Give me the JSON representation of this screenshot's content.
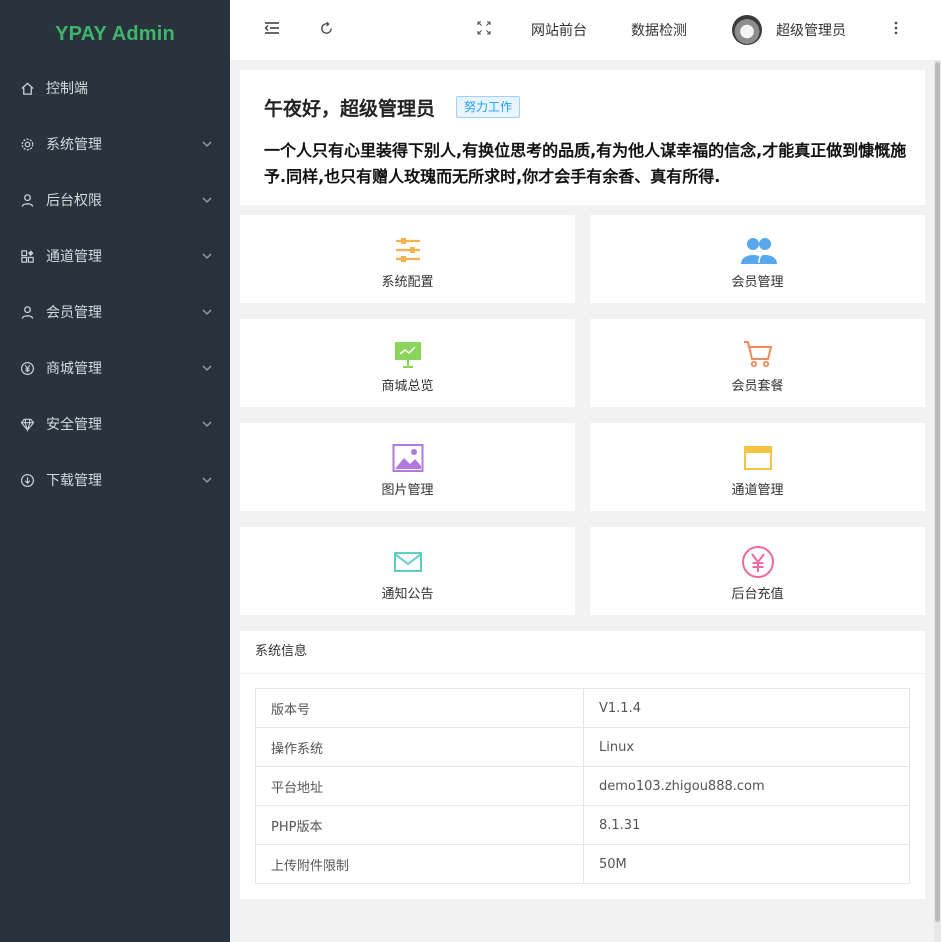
{
  "brand": "YPAY Admin",
  "sidebar": {
    "items": [
      {
        "label": "控制端",
        "icon": "home-icon",
        "has_children": false
      },
      {
        "label": "系统管理",
        "icon": "gear-icon",
        "has_children": true
      },
      {
        "label": "后台权限",
        "icon": "user-icon",
        "has_children": true
      },
      {
        "label": "通道管理",
        "icon": "apps-icon",
        "has_children": true
      },
      {
        "label": "会员管理",
        "icon": "user-icon",
        "has_children": true
      },
      {
        "label": "商城管理",
        "icon": "yen-icon",
        "has_children": true
      },
      {
        "label": "安全管理",
        "icon": "diamond-icon",
        "has_children": true
      },
      {
        "label": "下载管理",
        "icon": "download-icon",
        "has_children": true
      }
    ]
  },
  "header": {
    "site_front": "网站前台",
    "data_check": "数据检测",
    "username": "超级管理员"
  },
  "welcome": {
    "greeting": "午夜好，超级管理员",
    "badge": "努力工作",
    "quote": "一个人只有心里装得下别人,有换位思考的品质,有为他人谋幸福的信念,才能真正做到慷慨施予.同样,也只有赠人玫瑰而无所求时,你才会手有余香、真有所得."
  },
  "shortcuts": [
    {
      "label": "系统配置",
      "icon": "sliders-icon",
      "color": "#f5b04f"
    },
    {
      "label": "会员管理",
      "icon": "users-icon",
      "color": "#58a8ee"
    },
    {
      "label": "商城总览",
      "icon": "presentation-icon",
      "color": "#8bd45a"
    },
    {
      "label": "会员套餐",
      "icon": "cart-icon",
      "color": "#ef8a5f"
    },
    {
      "label": "图片管理",
      "icon": "image-icon",
      "color": "#b079e0"
    },
    {
      "label": "通道管理",
      "icon": "window-icon",
      "color": "#f5c242"
    },
    {
      "label": "通知公告",
      "icon": "mail-icon",
      "color": "#5fcfc4"
    },
    {
      "label": "后台充值",
      "icon": "yen-circle-icon",
      "color": "#ec6aa0"
    }
  ],
  "system_info": {
    "title": "系统信息",
    "rows": [
      {
        "key": "版本号",
        "value": "V1.1.4"
      },
      {
        "key": "操作系统",
        "value": "Linux"
      },
      {
        "key": "平台地址",
        "value": "demo103.zhigou888.com"
      },
      {
        "key": "PHP版本",
        "value": "8.1.31"
      },
      {
        "key": "上传附件限制",
        "value": "50M"
      }
    ]
  }
}
